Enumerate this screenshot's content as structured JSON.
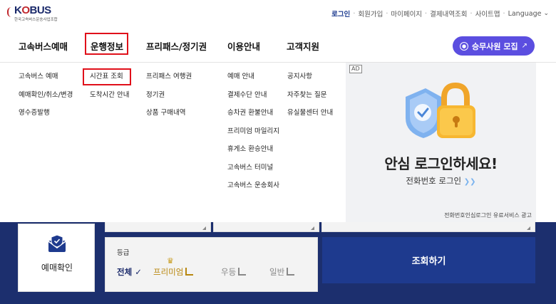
{
  "logo": {
    "text_a": "K",
    "text_o": "O",
    "text_b": "BUS",
    "subtitle": "한국고속버스운송사업조합"
  },
  "util_nav": {
    "items": [
      "로그인",
      "회원가입",
      "마이페이지",
      "결제내역조회",
      "사이트맵"
    ],
    "language": "Language"
  },
  "main_nav": {
    "items": [
      "고속버스예매",
      "운행정보",
      "프리패스/정기권",
      "이용안내",
      "고객지원"
    ],
    "recruit_button": "승무사원 모집"
  },
  "mega_menu": {
    "reservation": [
      "고속버스 예매",
      "예매확인/취소/변경",
      "영수증발행"
    ],
    "operation": [
      "시간표 조회",
      "도착시간 안내"
    ],
    "freepass": [
      "프리패스 여행권",
      "정기권",
      "상품 구매내역"
    ],
    "guide": [
      "예매 안내",
      "결제수단 안내",
      "승차권 환불안내",
      "프리미엄 마일리지",
      "휴게소 환승안내",
      "고속버스 터미널",
      "고속버스 운송회사"
    ],
    "support": [
      "공지사항",
      "자주찾는 질문",
      "유실물센터 안내"
    ]
  },
  "ad": {
    "tag": "AD",
    "headline": "안심 로그인하세요!",
    "subline": "전화번호 로그인",
    "footer": "전화번호인심로그인 유료서비스 광고"
  },
  "booking": {
    "confirm_label": "예매확인",
    "grade_title": "등급",
    "grades": {
      "all": "전체",
      "premium": "프리미엄",
      "excellent": "우등",
      "normal": "일반"
    },
    "search_button": "조회하기"
  },
  "colors": {
    "accent_purple": "#5b4ee0",
    "navy": "#1c2f6e",
    "highlight_red": "#e0101a",
    "premium_gold": "#b8870f"
  }
}
